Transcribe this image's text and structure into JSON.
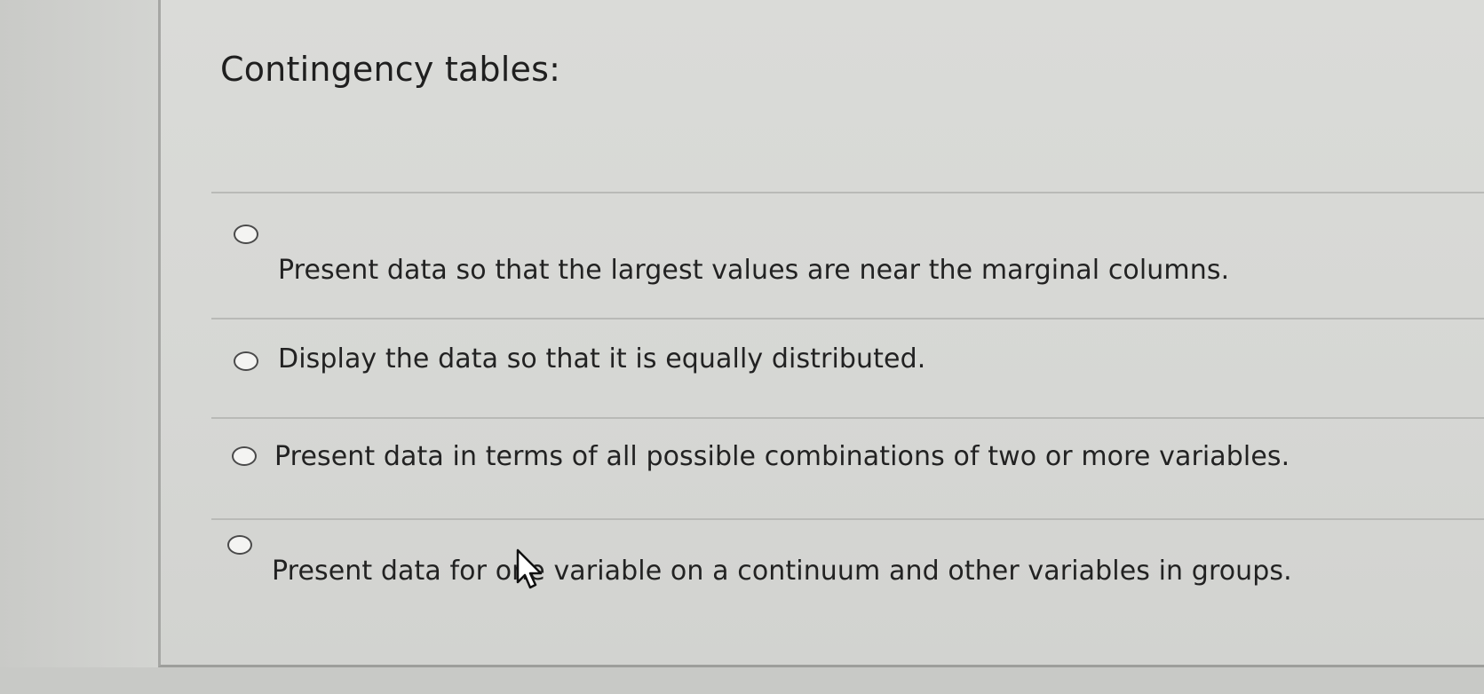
{
  "question": {
    "prompt": "Contingency tables:"
  },
  "choices": [
    {
      "label": "Present data so that the largest values are near the marginal columns."
    },
    {
      "label": "Display the data so that it is equally distributed."
    },
    {
      "label": "Present data in terms of all possible combinations of two or more variables."
    },
    {
      "label": "Present data for one variable on a continuum and other variables in groups."
    }
  ],
  "cursor": {
    "icon": "arrow-cursor-icon"
  }
}
